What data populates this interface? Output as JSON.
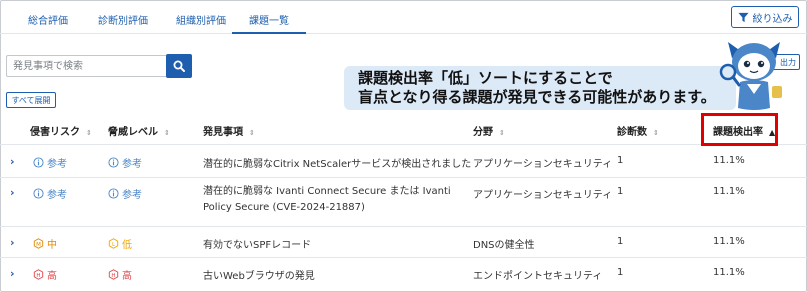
{
  "tabs": [
    {
      "label": "総合評価"
    },
    {
      "label": "診断別評価"
    },
    {
      "label": "組織別評価"
    },
    {
      "label": "課題一覧"
    }
  ],
  "filter_button": "絞り込み",
  "search": {
    "placeholder": "発見事項で検索"
  },
  "expand_all": "すべて展開",
  "export_label": "出力",
  "callout": {
    "line1": "課題検出率「低」ソートにすることで",
    "line2": "盲点となり得る課題が発見できる可能性があります。"
  },
  "table": {
    "headers": {
      "risk": "侵害リスク",
      "threat": "脅威レベル",
      "finding": "発見事項",
      "field": "分野",
      "count": "診断数",
      "rate": "課題検出率"
    },
    "rows": [
      {
        "risk": {
          "label": "参考",
          "level": "info"
        },
        "threat": {
          "label": "参考",
          "level": "info"
        },
        "finding": "潜在的に脆弱なCitrix NetScalerサービスが検出されました",
        "field": "アプリケーションセキュリティ",
        "count": "1",
        "rate": "11.1%"
      },
      {
        "risk": {
          "label": "参考",
          "level": "info"
        },
        "threat": {
          "label": "参考",
          "level": "info"
        },
        "finding": "潜在的に脆弱な Ivanti Connect Secure または Ivanti Policy Secure (CVE-2024-21887)",
        "field": "アプリケーションセキュリティ",
        "count": "1",
        "rate": "11.1%"
      },
      {
        "risk": {
          "label": "中",
          "level": "medium"
        },
        "threat": {
          "label": "低",
          "level": "low"
        },
        "finding": "有効でないSPFレコード",
        "field": "DNSの健全性",
        "count": "1",
        "rate": "11.1%"
      },
      {
        "risk": {
          "label": "高",
          "level": "high"
        },
        "threat": {
          "label": "高",
          "level": "high"
        },
        "finding": "古いWebブラウザの発見",
        "field": "エンドポイントセキュリティ",
        "count": "1",
        "rate": "11.1%"
      }
    ]
  },
  "colors": {
    "accent": "#1d5fae",
    "highlight_border": "#e00000",
    "callout_bg": "#dce9f7",
    "info": "#4a86c8",
    "medium": "#e08a00",
    "low": "#f0a500",
    "high": "#e0474c"
  },
  "icons": {
    "filter": "funnel-icon",
    "search": "magnifier-icon",
    "expand_row": "chevron-right-icon",
    "sort": "sort-icon",
    "info": "info-circle-icon",
    "medium": "medium-letter-icon",
    "low": "low-letter-icon",
    "high": "high-letter-icon"
  }
}
